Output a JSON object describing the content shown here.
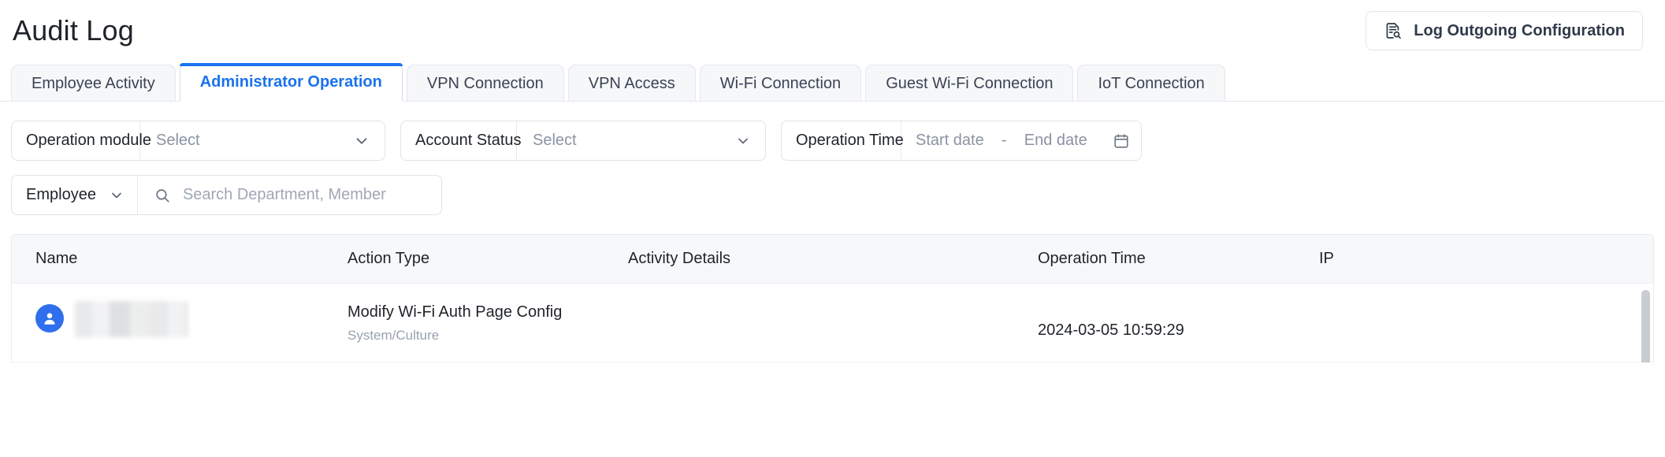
{
  "header": {
    "title": "Audit Log",
    "log_config_button": {
      "label": "Log Outgoing Configuration",
      "icon": "document-search-icon"
    }
  },
  "tabs": [
    {
      "label": "Employee Activity",
      "active": false
    },
    {
      "label": "Administrator Operation",
      "active": true
    },
    {
      "label": "VPN Connection",
      "active": false
    },
    {
      "label": "VPN Access",
      "active": false
    },
    {
      "label": "Wi-Fi Connection",
      "active": false
    },
    {
      "label": "Guest Wi-Fi Connection",
      "active": false
    },
    {
      "label": "IoT Connection",
      "active": false
    }
  ],
  "filters": {
    "operation_module": {
      "label": "Operation module",
      "placeholder": "Select",
      "value": "",
      "icon": "chevron-down-icon"
    },
    "account_status": {
      "label": "Account Status",
      "placeholder": "Select",
      "value": "",
      "icon": "chevron-down-icon"
    },
    "operation_time": {
      "label": "Operation Time",
      "start_placeholder": "Start date",
      "separator": "-",
      "end_placeholder": "End date",
      "icon": "calendar-icon"
    },
    "scope_select": {
      "value": "Employee",
      "icon": "chevron-down-icon"
    },
    "search": {
      "placeholder": "Search Department, Member",
      "value": "",
      "icon": "search-icon"
    }
  },
  "table": {
    "columns": [
      "Name",
      "Action Type",
      "Activity Details",
      "Operation Time",
      "IP"
    ],
    "rows": [
      {
        "name": "",
        "name_redacted": true,
        "avatar_icon": "user-avatar-icon",
        "action_type": "Modify Wi-Fi Auth Page Config",
        "action_detail": "System/Culture",
        "activity_details": "",
        "operation_time": "2024-03-05 10:59:29",
        "ip": "",
        "ip_redacted": true
      }
    ]
  },
  "colors": {
    "accent": "#1a72ed",
    "avatar": "#2f6fed",
    "text": "#1f2329",
    "muted": "#8a93a3",
    "border": "#dfe3e9",
    "header_bg": "#f7f8fa"
  }
}
